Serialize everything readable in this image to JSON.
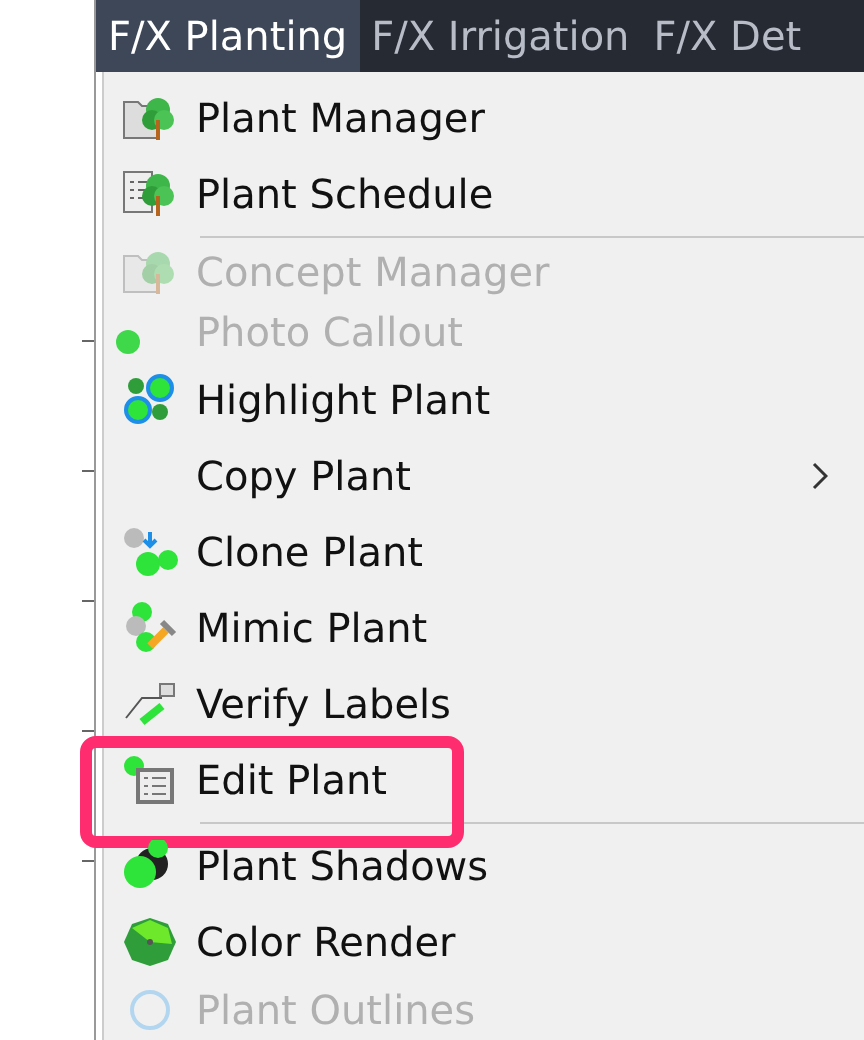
{
  "menubar": [
    {
      "label": "F/X Planting",
      "selected": true
    },
    {
      "label": "F/X Irrigation",
      "selected": false
    },
    {
      "label": "F/X Det",
      "selected": false
    }
  ],
  "menu": [
    {
      "kind": "item",
      "label": "Plant Manager",
      "faded": false,
      "submenu": false,
      "highlighted": false
    },
    {
      "kind": "item",
      "label": "Plant Schedule",
      "faded": false,
      "submenu": false,
      "highlighted": false
    },
    {
      "kind": "separator"
    },
    {
      "kind": "item",
      "label": "Concept Manager",
      "faded": true,
      "submenu": false,
      "highlighted": false
    },
    {
      "kind": "item",
      "label": "Photo Callout",
      "faded": true,
      "submenu": false,
      "highlighted": false
    },
    {
      "kind": "item",
      "label": "Highlight Plant",
      "faded": false,
      "submenu": false,
      "highlighted": false
    },
    {
      "kind": "item",
      "label": "Copy Plant",
      "faded": false,
      "submenu": true,
      "highlighted": false
    },
    {
      "kind": "item",
      "label": "Clone Plant",
      "faded": false,
      "submenu": false,
      "highlighted": false
    },
    {
      "kind": "item",
      "label": "Mimic Plant",
      "faded": false,
      "submenu": false,
      "highlighted": false
    },
    {
      "kind": "item",
      "label": "Verify Labels",
      "faded": false,
      "submenu": false,
      "highlighted": false
    },
    {
      "kind": "item",
      "label": "Edit Plant",
      "faded": false,
      "submenu": false,
      "highlighted": true
    },
    {
      "kind": "separator"
    },
    {
      "kind": "item",
      "label": "Plant Shadows",
      "faded": false,
      "submenu": false,
      "highlighted": false
    },
    {
      "kind": "item",
      "label": "Color Render",
      "faded": false,
      "submenu": false,
      "highlighted": false
    },
    {
      "kind": "item",
      "label": "Plant Outlines",
      "faded": true,
      "submenu": false,
      "highlighted": false
    }
  ]
}
